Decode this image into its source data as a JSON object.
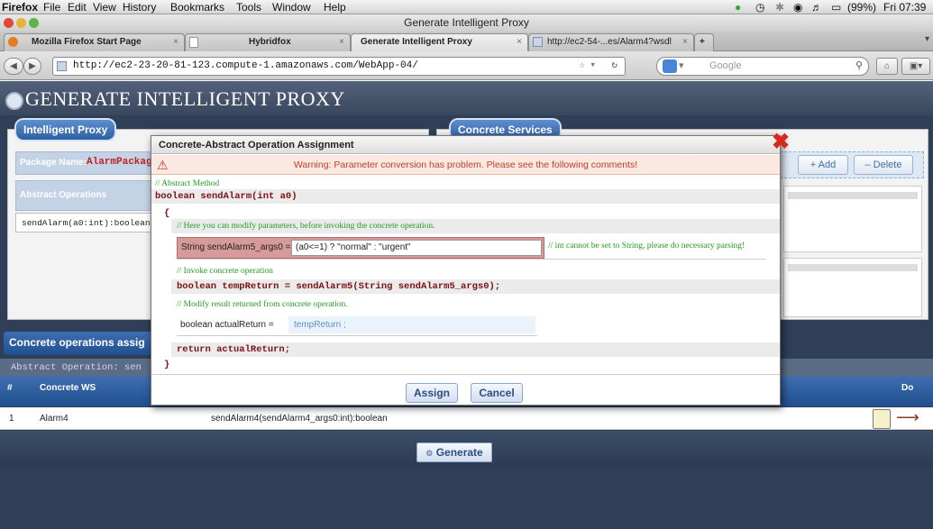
{
  "menubar": {
    "app": "Firefox",
    "items": [
      "File",
      "Edit",
      "View",
      "History",
      "Bookmarks",
      "Tools",
      "Window",
      "Help"
    ],
    "battery": "(99%)",
    "clock": "Fri 07:39"
  },
  "window": {
    "title": "Generate Intelligent Proxy"
  },
  "tabs": [
    {
      "label": "Mozilla Firefox Start Page"
    },
    {
      "label": "Hybridfox"
    },
    {
      "label": "Generate Intelligent Proxy"
    },
    {
      "label": "http://ec2-54-...es/Alarm4?wsdl"
    }
  ],
  "nav": {
    "url": "http://ec2-23-20-81-123.compute-1.amazonaws.com/WebApp-04/",
    "search_placeholder": "Google"
  },
  "page": {
    "title": "GENERATE INTELLIGENT PROXY",
    "intelligent_proxy_tab": "Intelligent Proxy",
    "package_label": "Package Name:",
    "package_value": "AlarmPackage",
    "abstract_ops_header": "Abstract Operations",
    "abstract_op_item": "sendAlarm(a0:int):boolean",
    "concrete_services_tab": "Concrete Services",
    "add_label": "+ Add",
    "delete_label": "– Delete",
    "concrete_assign_title": "Concrete operations assig",
    "abstract_operation_label": "Abstract Operation: sen",
    "col_num": "#",
    "col_ws": "Concrete WS",
    "col_do": "Do",
    "row_index": "1",
    "row_ws": "Alarm4",
    "row_op": "sendAlarm4(sendAlarm4_args0:int):boolean",
    "generate_label": "Generate"
  },
  "dialog": {
    "title": "Concrete-Abstract Operation Assignment",
    "warning": "Warning: Parameter conversion has problem. Please see the following comments!",
    "comment_abstract": "// Abstract Method",
    "method_sig": "boolean sendAlarm(int a0)",
    "open_brace": "{",
    "comment_modify_params": "// Here you can modify parameters, before invoking the concrete operation.",
    "param_label": "String sendAlarm5_args0  =",
    "param_value": "(a0<=1) ? \"normal\" : \"urgent\"",
    "param_comment": "// int cannot be set to String, please do necessary parsing!",
    "comment_invoke": "// Invoke concrete operation",
    "invoke_line": "boolean tempReturn = sendAlarm5(String sendAlarm5_args0);",
    "comment_modify_result": "// Modify result returned from concrete operation.",
    "result_label": "boolean actualReturn  =",
    "result_value": "tempReturn ;",
    "return_line": "return actualReturn;",
    "close_brace": "}",
    "assign_label": "Assign",
    "cancel_label": "Cancel"
  },
  "colors": {
    "accent": "#2f5fa3",
    "warning": "#c43b2f",
    "page_bg": "#2f3f57"
  }
}
